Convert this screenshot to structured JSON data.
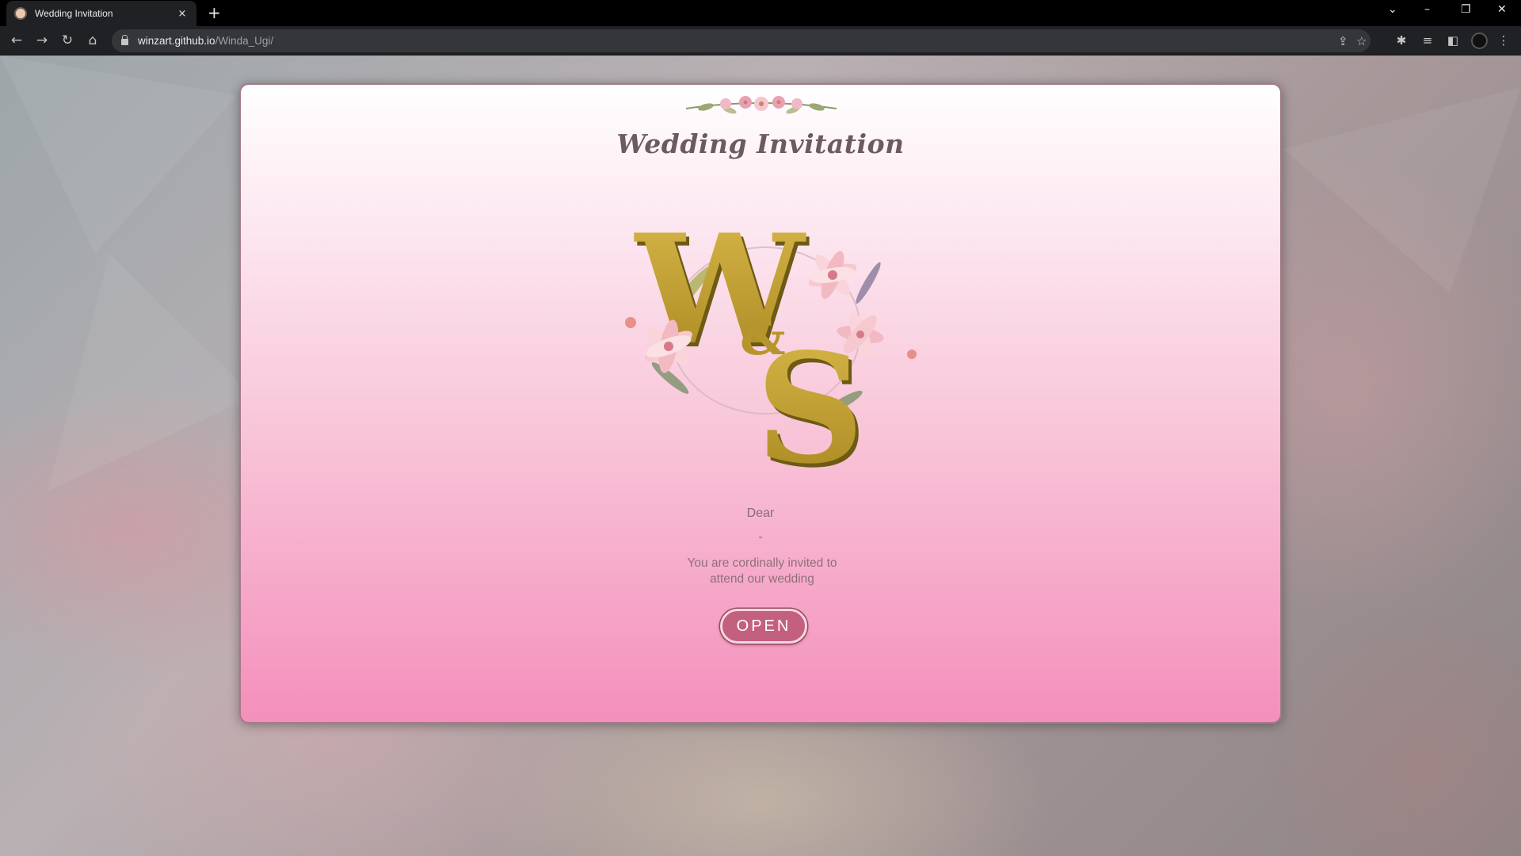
{
  "browser": {
    "tab_title": "Wedding Invitation",
    "tab_close": "×",
    "new_tab": "+",
    "url_host": "winzart.github.io",
    "url_path": "/Winda_Ugi/",
    "window_controls": {
      "menu": "⌄",
      "minimize": "–",
      "restore": "❐",
      "close": "✕"
    },
    "nav": {
      "back": "←",
      "forward": "→",
      "reload": "↻",
      "home": "⌂"
    },
    "toolbar_icons": {
      "share": "⇪",
      "bookmark": "☆",
      "extensions": "✱",
      "reading_list": "≡",
      "side_panel": "◧",
      "menu": "⋮"
    }
  },
  "invitation": {
    "title": "Wedding Invitation",
    "monogram": {
      "letter1": "W",
      "ampersand": "&",
      "letter2": "S"
    },
    "dear": "Dear",
    "guest_name": "-",
    "invite_line1": "You are cordinally invited to",
    "invite_line2": "attend our wedding",
    "open_button": "OPEN"
  },
  "colors": {
    "card_top": "#ffffff",
    "card_bottom": "#f48fbb",
    "monogram_gold": "#c9a632",
    "button": "#c4607f",
    "title_text": "#6c5a60"
  }
}
